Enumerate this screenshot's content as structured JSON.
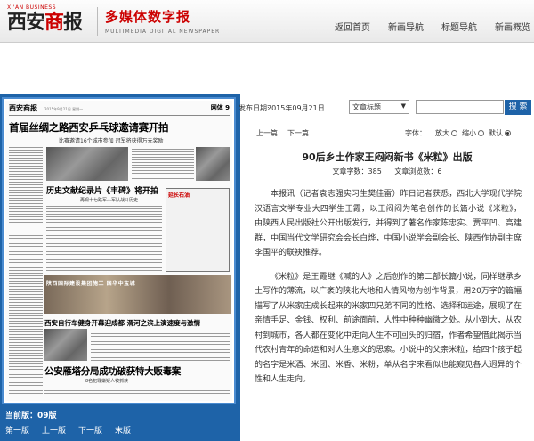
{
  "header": {
    "logo_top": "XI'AN BUSINESS",
    "logo_part1": "西安",
    "logo_part2": "商",
    "logo_part3": "报",
    "brand_cn": "多媒体数字报",
    "brand_en": "MULTIMEDIA DIGITAL NEWSPAPER",
    "nav": [
      "返回首页",
      "新画导航",
      "标题导航",
      "新画概览"
    ]
  },
  "paper_preview": {
    "masthead_name": "西安商报",
    "masthead_section": "网体 9",
    "headline1": "首届丝绸之路西安乒乓球邀请赛开拍",
    "sub1": "比赛邀请16个城市参加   冠军将获得万元奖励",
    "headline2": "历史文献纪录片《丰碑》将开拍",
    "sub2": "再现十七路军人军队战斗历史",
    "box_title": "延长石油",
    "banner_text": "陕西国际建设集团施工 国华中宝城",
    "headline3": "西安自行车健身开幕迎成都   渭河之滨上演速度与激情",
    "headline4": "公安雁塔分局成功破获特大贩毒案",
    "sub4": "8名犯罪嫌疑人被抓获"
  },
  "pager": {
    "current_label": "当前版：",
    "current_value": "09版",
    "buttons": [
      "第一版",
      "上一版",
      "下一版",
      "末版"
    ]
  },
  "toolbar": {
    "pubdate_label": "发布日期:",
    "pubdate": "2015年09月21日",
    "select_value": "文章标题",
    "search_value": "",
    "search_button": "搜 索"
  },
  "article_nav": {
    "prev": "上一篇",
    "next": "下一篇",
    "font_label": "字体：",
    "font_options": [
      "放大",
      "缩小",
      "默认"
    ]
  },
  "article": {
    "title": "90后乡土作家王闷闷新书《米粒》出版",
    "char_count": "文章字数：385",
    "read_count": "文章浏览数：6",
    "paragraphs": [
      "本报讯（记者袁志强实习生樊佳雷）昨日记者获悉，西北大学现代学院汉语言文学专业大四学生王霞，以王闷闷为笔名创作的长篇小说《米粒》，由陕西人民出版社公开出版发行，并得到了著名作家陈忠实、贾平凹、高建群，中国当代文学研究会会长白烨，中国小说学会副会长、陕西作协副主席李国平的联袂推荐。",
      "《米粒》是王霞继《喊的人》之后创作的第二部长篇小说，同样继承乡土写作的薄流，以广袤的陕北大地和人情风物为创作背景，用20万字的篇幅描写了从米家庄成长起来的米家四兄弟不同的性格、选择和运途，展现了在亲情手足、金钱、权利、前途面前，人性中种种幽微之处。从小到大，从农村到城市，各人都在变化中走向人生不可回头的归宿，作者希望借此揭示当代农村青年的命运和对人生意义的思索。小说中的父亲米粒，给四个孩子起的名字是米酒、米团、米香、米粉，单从名字来看似也能窥见各人迥异的个性和人生走向。"
    ]
  },
  "colors": {
    "brand_red": "#cc0000",
    "panel_blue": "#1e63a8"
  }
}
